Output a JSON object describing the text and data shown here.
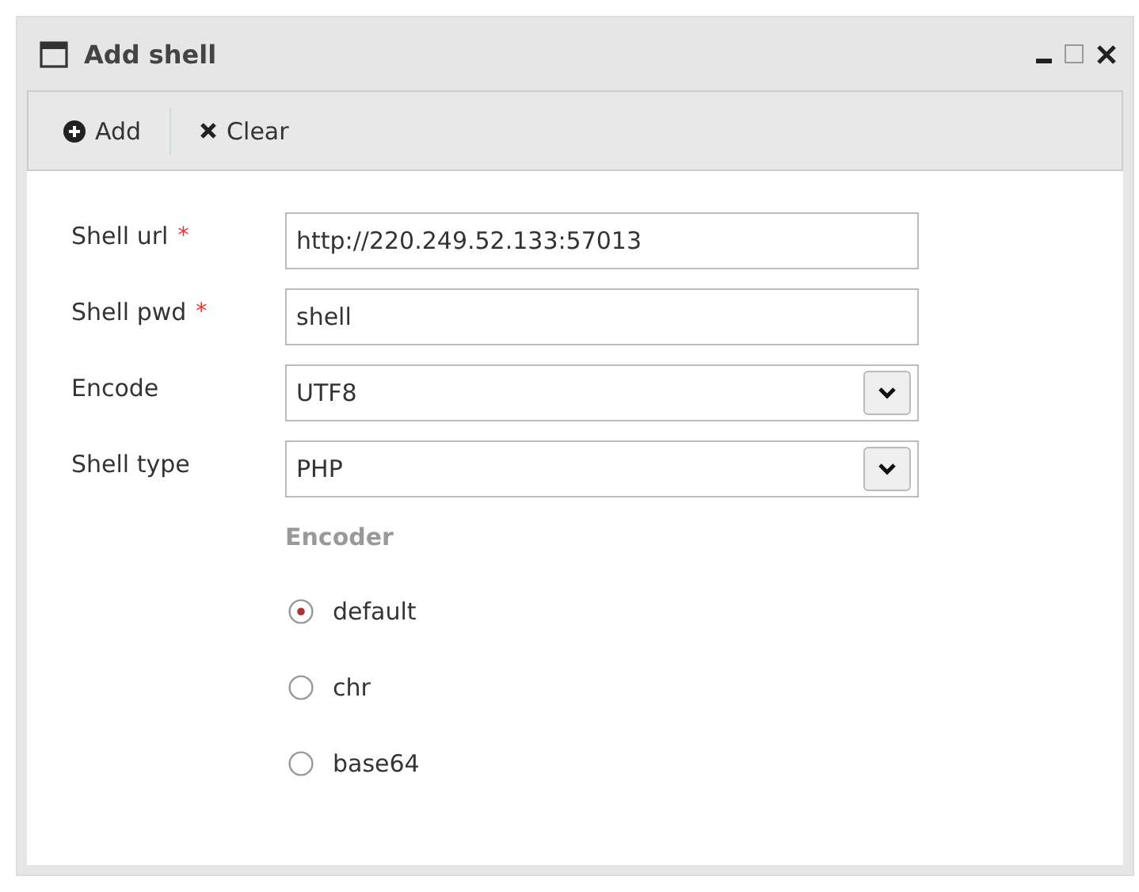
{
  "window": {
    "title": "Add shell"
  },
  "toolbar": [
    {
      "label": "Add",
      "kind": "add"
    },
    {
      "label": "Clear",
      "kind": "clear"
    }
  ],
  "fields": [
    {
      "label": "Shell url",
      "required_mark": "*",
      "kind": "text",
      "value": "http://220.249.52.133:57013"
    },
    {
      "label": "Shell pwd",
      "required_mark": "*",
      "kind": "text",
      "value": "shell"
    },
    {
      "label": "Encode",
      "kind": "select",
      "value": "UTF8"
    },
    {
      "label": "Shell type",
      "kind": "select",
      "value": "PHP"
    }
  ],
  "encoder": {
    "title": "Encoder",
    "options": [
      {
        "label": "default",
        "selected": true
      },
      {
        "label": "chr",
        "selected": false
      },
      {
        "label": "base64",
        "selected": false
      }
    ]
  }
}
